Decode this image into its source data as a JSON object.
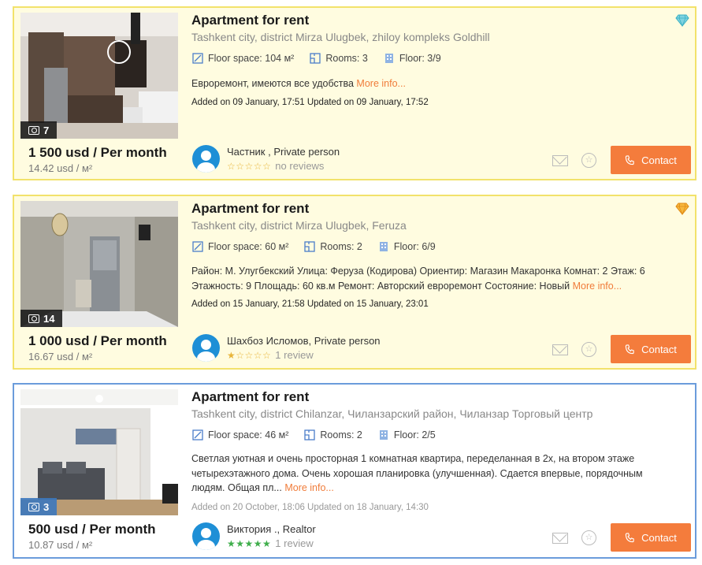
{
  "listings": [
    {
      "photo_count": "7",
      "price": "1 500 usd / Per month",
      "price_per_sqm": "14.42 usd / м²",
      "title": "Apartment for rent",
      "address": "Tashkent city, district Mirza Ulugbek, zhiloy kompleks Goldhill",
      "floor_space": "Floor space: 104 м²",
      "rooms": "Rooms: 3",
      "floor": "Floor: 3/9",
      "description": "Евроремонт, имеются все удобства",
      "more_label": "More info...",
      "added": "Added on 09 January, 17:51 Updated on 09 January, 17:52",
      "owner_name": "Частник , Private person",
      "stars": "☆☆☆☆☆",
      "reviews": "no reviews",
      "contact_label": "Contact",
      "badge": "diamond-cyan",
      "highlight_color": "#fffce0"
    },
    {
      "photo_count": "14",
      "price": "1 000 usd / Per month",
      "price_per_sqm": "16.67 usd / м²",
      "title": "Apartment for rent",
      "address": "Tashkent city, district Mirza Ulugbek, Feruza",
      "floor_space": "Floor space: 60 м²",
      "rooms": "Rooms: 2",
      "floor": "Floor: 6/9",
      "description": "Район: М. Улугбекский Улица: Феруза (Кодирова) Ориентир: Магазин Макаронка Комнат: 2 Этаж: 6 Этажность: 9 Площадь: 60 кв.м Ремонт: Авторский евроремонт Состояние: Новый",
      "more_label": "More info...",
      "added": "Added on 15 January, 21:58 Updated on 15 January, 23:01",
      "owner_name": "Шахбоз Исломов, Private person",
      "stars": "★☆☆☆☆",
      "reviews": "1 review",
      "contact_label": "Contact",
      "badge": "diamond-orange",
      "highlight_color": "#fffce0"
    },
    {
      "photo_count": "3",
      "price": "500 usd / Per month",
      "price_per_sqm": "10.87 usd / м²",
      "title": "Apartment for rent",
      "address": "Tashkent city, district Chilanzar, Чиланзарский район, Чиланзар Торговый центр",
      "floor_space": "Floor space: 46 м²",
      "rooms": "Rooms: 2",
      "floor": "Floor: 2/5",
      "description": "Светлая уютная и очень просторная 1 комнатная квартира, переделанная в 2х, на втором этаже четырехэтажного дома. Очень хорошая планировка (улучшенная). Сдается впервые, порядочным людям. Общая пл...",
      "more_label": "More info...",
      "added": "Added on 20 October, 18:06 Updated on 18 January, 14:30",
      "owner_name": "Виктория ., Realtor",
      "stars": "★★★★★",
      "reviews": "1 review",
      "contact_label": "Contact",
      "badge": "",
      "highlight_color": "#ffffff"
    }
  ],
  "colors": {
    "accent": "#f47c3c",
    "highlight_border": "#f2e26b",
    "plain_border": "#6b9cdb",
    "avatar": "#1e8fd6",
    "star_gold": "#e8b53a",
    "star_green": "#3fae4b"
  }
}
